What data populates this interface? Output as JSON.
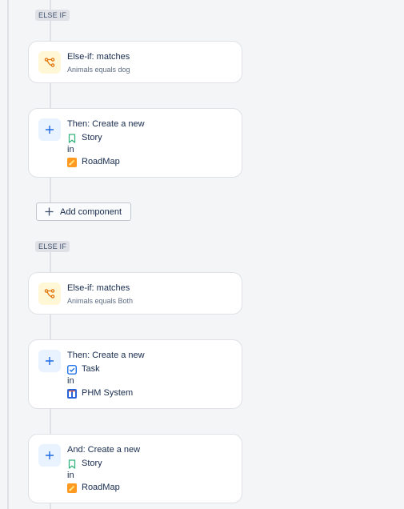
{
  "flow": {
    "pill1": "ELSE IF",
    "card1": {
      "title": "Else-if: matches",
      "subtitle": "Animals equals dog"
    },
    "card2": {
      "title": "Then: Create a new",
      "issue_type": "Story",
      "in_label": "in",
      "project": "RoadMap"
    },
    "add_component": "Add component",
    "pill2": "ELSE IF",
    "card3": {
      "title": "Else-if: matches",
      "subtitle": "Animals equals Both"
    },
    "card4": {
      "title": "Then: Create a new",
      "issue_type": "Task",
      "in_label": "in",
      "project": "PHM System"
    },
    "card5": {
      "title": "And: Create a new",
      "issue_type": "Story",
      "in_label": "in",
      "project": "RoadMap"
    }
  },
  "colors": {
    "condition_icon": "#e2740c",
    "action_icon": "#1d6ae5",
    "story": "#36b37e",
    "task": "#0c66e4",
    "roadmap": "#ff991f",
    "phm": "#2b63d9"
  },
  "icons": {
    "condition": "branch-icon",
    "action": "plus-icon",
    "story": "bookmark-icon",
    "task": "checkbox-icon",
    "roadmap_project": "pencil-project-icon",
    "phm_project": "building-project-icon"
  }
}
